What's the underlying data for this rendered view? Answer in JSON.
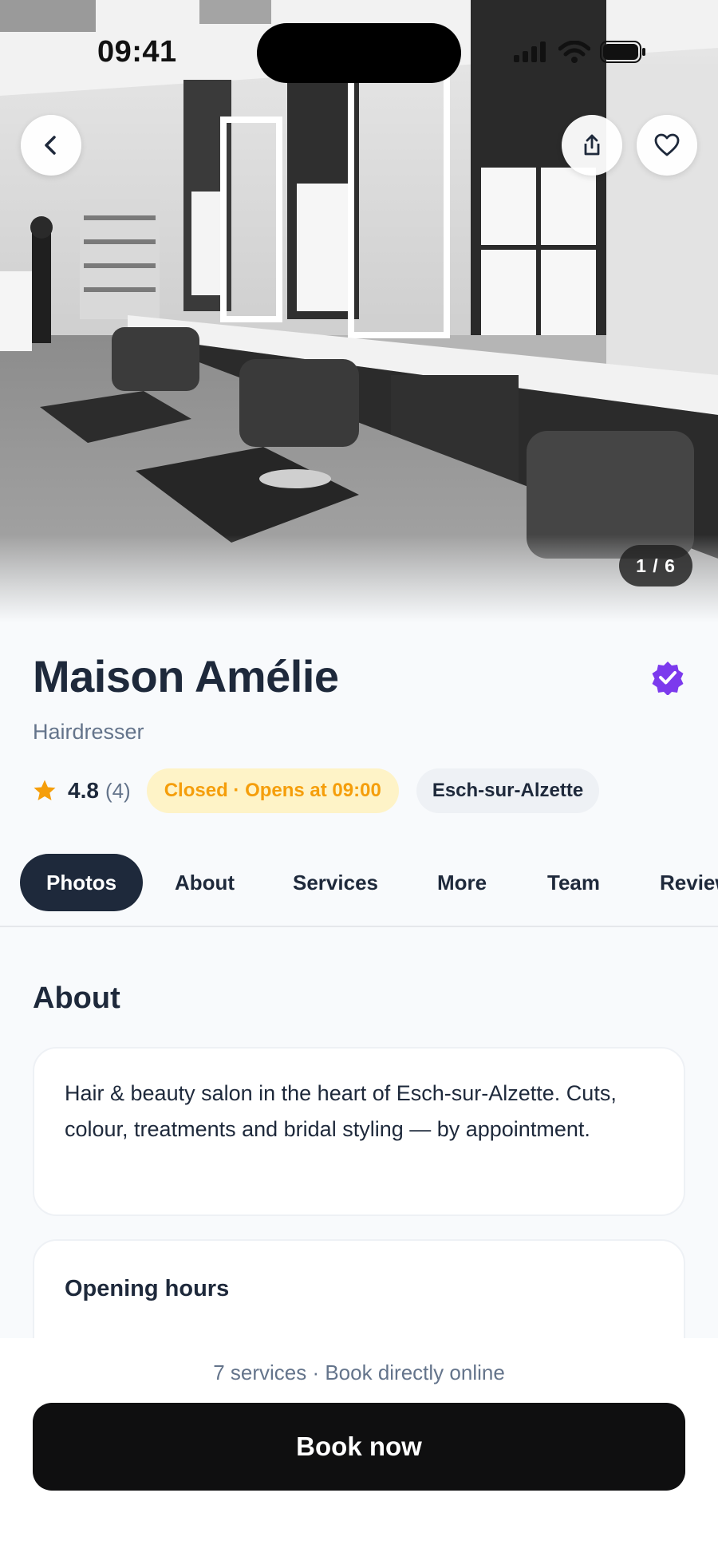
{
  "status_bar": {
    "time": "09:41"
  },
  "hero": {
    "photo_counter": "1 / 6"
  },
  "salon": {
    "name": "Maison Amélie",
    "category": "Hairdresser",
    "rating": "4.8",
    "rating_count": "(4)",
    "status": "Closed · Opens at 09:00",
    "city": "Esch-sur-Alzette"
  },
  "tabs": [
    "Photos",
    "About",
    "Services",
    "More",
    "Team",
    "Reviews"
  ],
  "about": {
    "title": "About",
    "description": "Hair & beauty salon in the heart of Esch-sur-Alzette. Cuts, colour, treatments and bridal styling — by appointment.",
    "opening_hours_title": "Opening hours"
  },
  "booking": {
    "info": "7 services · Book directly online",
    "button_label": "Book now"
  },
  "colors": {
    "primary": "#1e293b",
    "muted": "#64748b",
    "status_bg": "#fef3c7",
    "status_text": "#f59e0b",
    "verified": "#7c3aed",
    "star": "#f59e0b",
    "cta": "#0f0f10"
  },
  "icons": {
    "back": "chevron-left-icon",
    "share": "share-icon",
    "favorite": "heart-icon",
    "verified": "verified-badge-icon",
    "rating": "star-icon"
  }
}
